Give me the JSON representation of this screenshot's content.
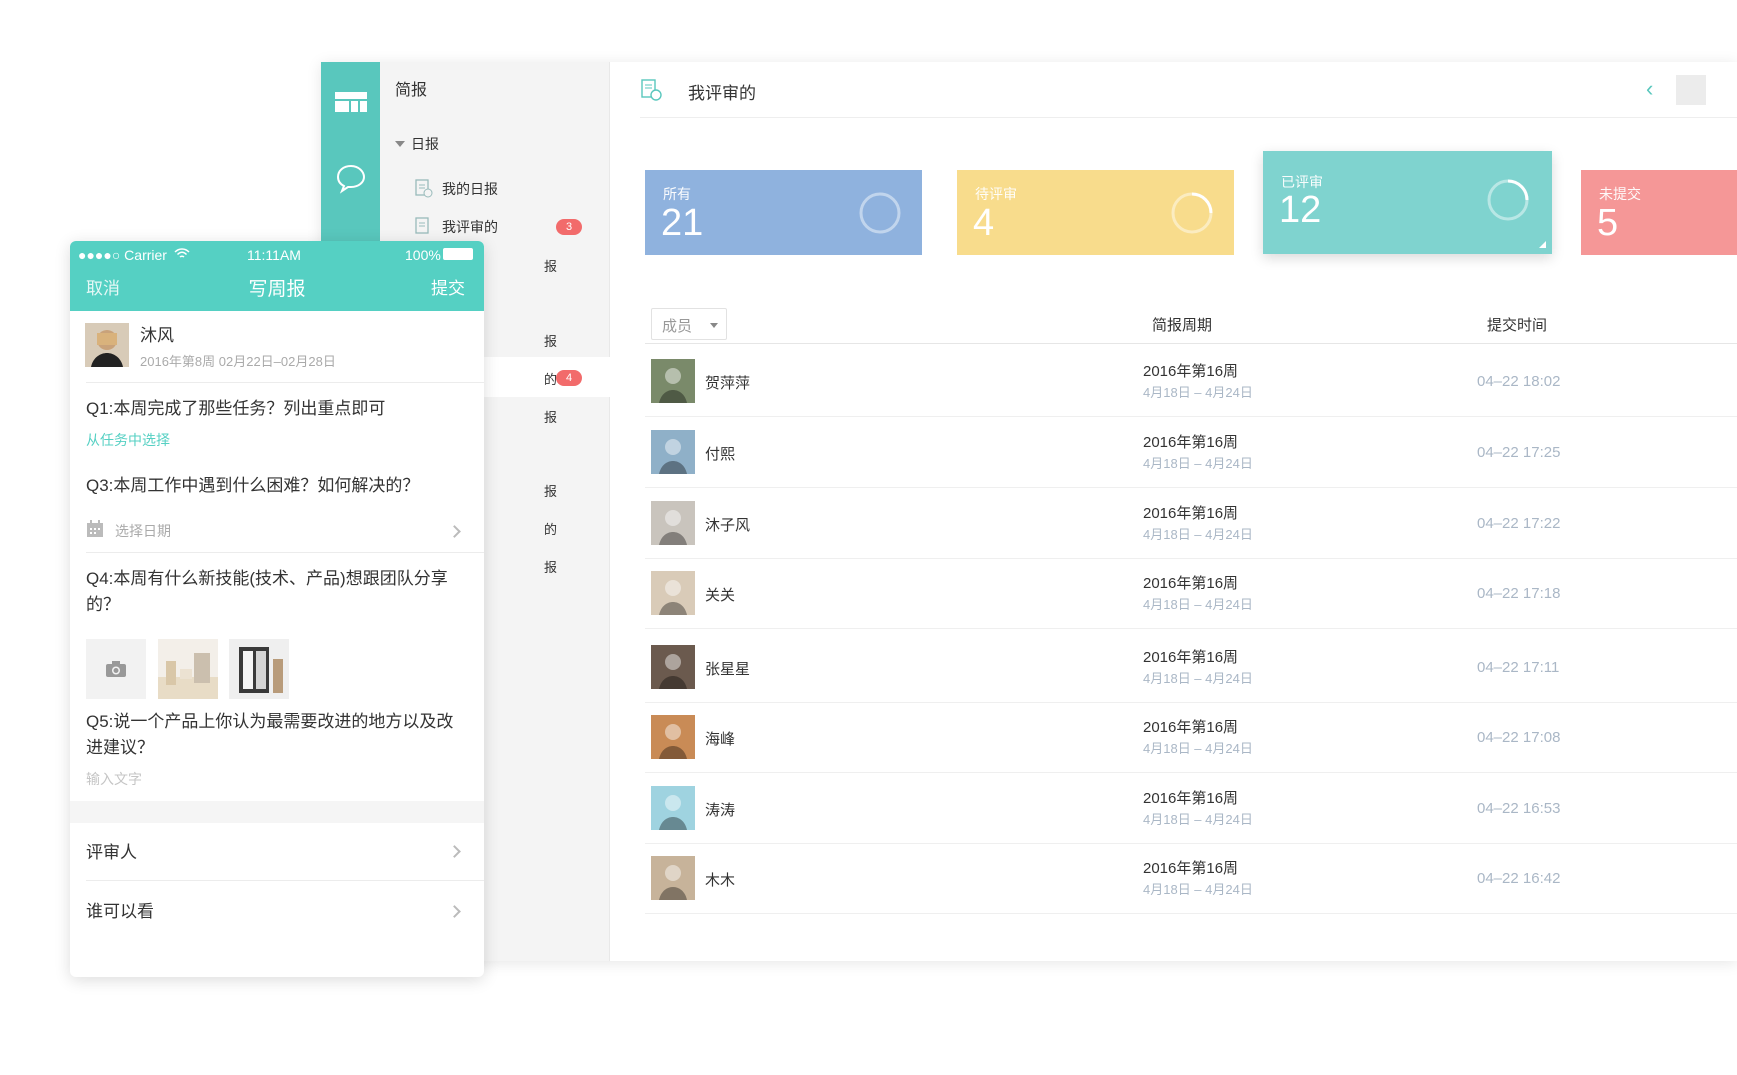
{
  "desktop": {
    "sidebar": {
      "title": "简报",
      "group": "日报",
      "items": [
        {
          "label": "我的日报"
        },
        {
          "label": "我评审的",
          "badge": "3"
        }
      ],
      "fragments": [
        "报",
        "报",
        "的",
        "报",
        "报",
        "的",
        "报"
      ],
      "active_badge": "4"
    },
    "header": {
      "title": "我评审的"
    },
    "cards": [
      {
        "label": "所有",
        "value": "21",
        "color": "#8fb2de"
      },
      {
        "label": "待评审",
        "value": "4",
        "color": "#f8dc8c"
      },
      {
        "label": "已评审",
        "value": "12",
        "color": "#7fd3cf"
      },
      {
        "label": "未提交",
        "value": "5",
        "color": "#f59797"
      }
    ],
    "table": {
      "filter_label": "成员",
      "columns": [
        "简报周期",
        "提交时间"
      ],
      "rows": [
        {
          "name": "贺萍萍",
          "week": "2016年第16周",
          "range": "4月18日 – 4月24日",
          "time": "04–22 18:02"
        },
        {
          "name": "付熙",
          "week": "2016年第16周",
          "range": "4月18日 – 4月24日",
          "time": "04–22 17:25"
        },
        {
          "name": "沐子风",
          "week": "2016年第16周",
          "range": "4月18日 – 4月24日",
          "time": "04–22 17:22"
        },
        {
          "name": "关关",
          "week": "2016年第16周",
          "range": "4月18日 – 4月24日",
          "time": "04–22 17:18"
        },
        {
          "name": "张星星",
          "week": "2016年第16周",
          "range": "4月18日 – 4月24日",
          "time": "04–22 17:11"
        },
        {
          "name": "海峰",
          "week": "2016年第16周",
          "range": "4月18日 – 4月24日",
          "time": "04–22 17:08"
        },
        {
          "name": "涛涛",
          "week": "2016年第16周",
          "range": "4月18日 – 4月24日",
          "time": "04–22 16:53"
        },
        {
          "name": "木木",
          "week": "2016年第16周",
          "range": "4月18日 – 4月24日",
          "time": "04–22 16:42"
        }
      ]
    }
  },
  "phone": {
    "status": {
      "carrier": "●●●●○ Carrier",
      "time": "11:11AM",
      "battery": "100%"
    },
    "nav": {
      "cancel": "取消",
      "title": "写周报",
      "submit": "提交"
    },
    "user": {
      "name": "沐风",
      "period": "2016年第8周 02月22日–02月28日"
    },
    "q1": "Q1:本周完成了那些任务？列出重点即可",
    "q1_link": "从任务中选择",
    "q3": "Q3:本周工作中遇到什么困难？如何解决的？",
    "date_placeholder": "选择日期",
    "q4": "Q4:本周有什么新技能(技术、产品)想跟团队分享的？",
    "q5": "Q5:说一个产品上你认为最需要改进的地方以及改进建议？",
    "input_placeholder": "输入文字",
    "reviewer": "评审人",
    "visibility": "谁可以看",
    "accent": "#55d0c3"
  }
}
